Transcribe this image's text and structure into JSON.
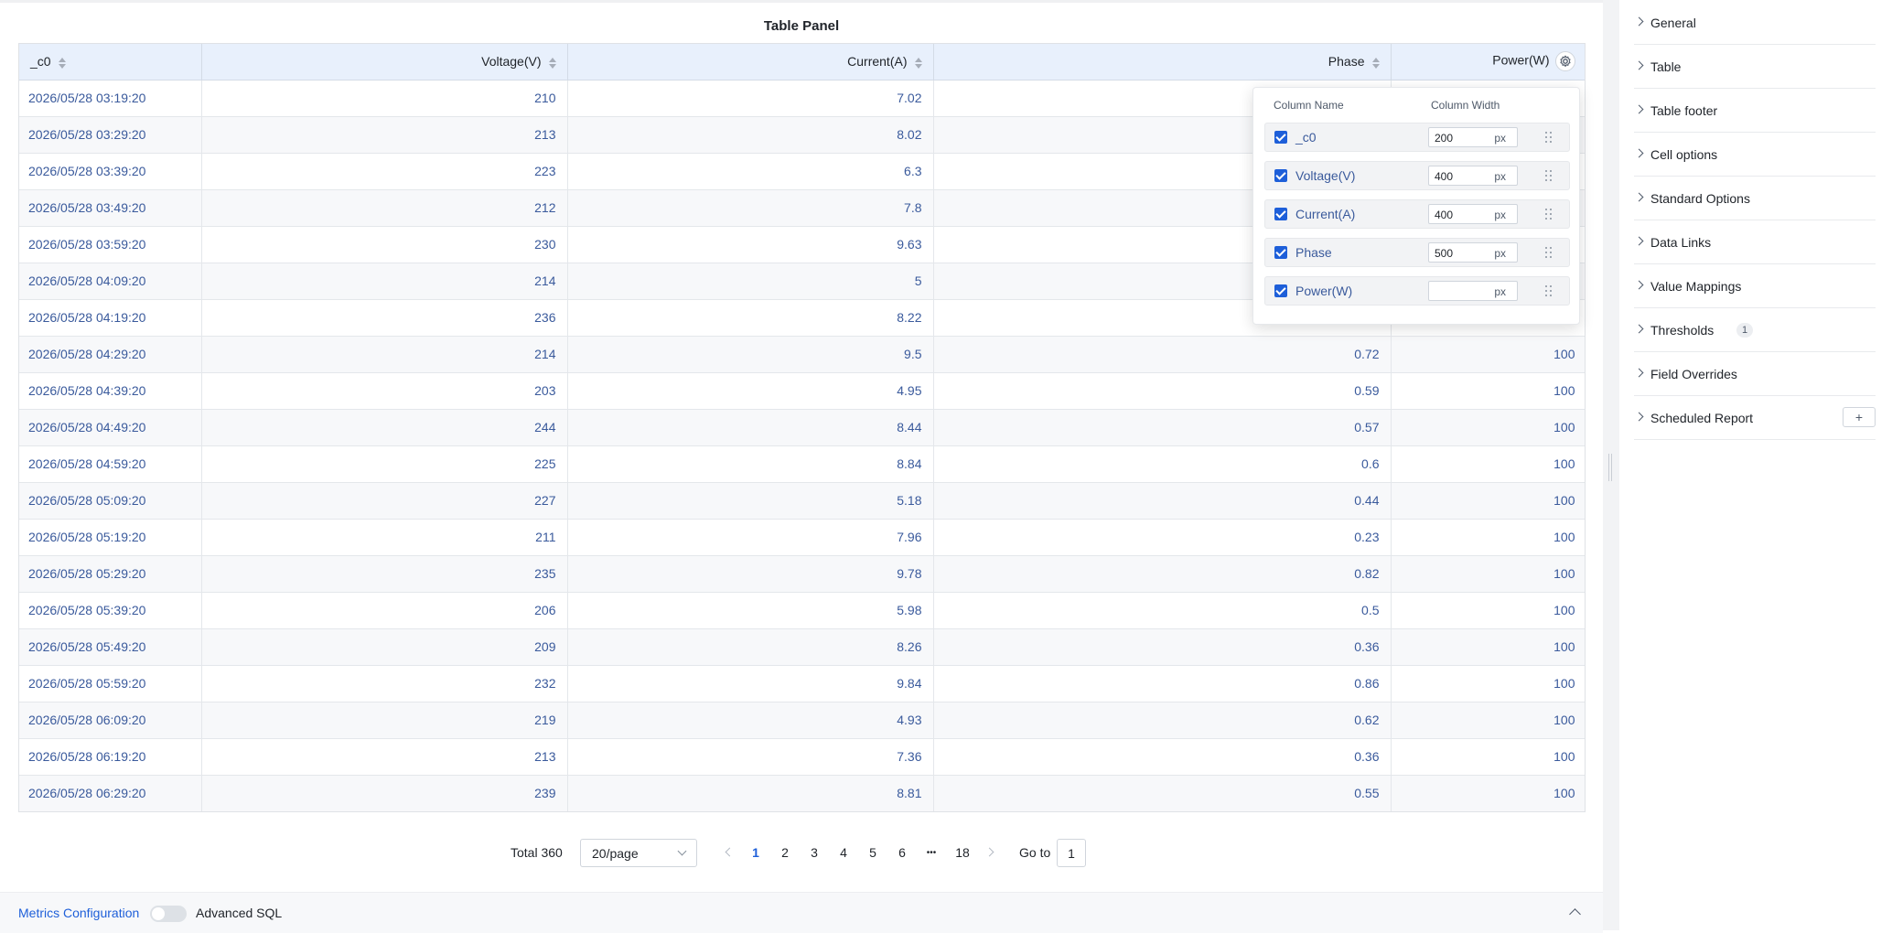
{
  "panel": {
    "title": "Table Panel"
  },
  "table": {
    "columns": [
      {
        "label": "_c0"
      },
      {
        "label": "Voltage(V)"
      },
      {
        "label": "Current(A)"
      },
      {
        "label": "Phase"
      },
      {
        "label": "Power(W)"
      }
    ],
    "rows": [
      [
        "2026/05/28 03:19:20",
        "210",
        "7.02",
        "",
        ""
      ],
      [
        "2026/05/28 03:29:20",
        "213",
        "8.02",
        "",
        ""
      ],
      [
        "2026/05/28 03:39:20",
        "223",
        "6.3",
        "",
        ""
      ],
      [
        "2026/05/28 03:49:20",
        "212",
        "7.8",
        "",
        ""
      ],
      [
        "2026/05/28 03:59:20",
        "230",
        "9.63",
        "",
        ""
      ],
      [
        "2026/05/28 04:09:20",
        "214",
        "5",
        "",
        ""
      ],
      [
        "2026/05/28 04:19:20",
        "236",
        "8.22",
        "",
        ""
      ],
      [
        "2026/05/28 04:29:20",
        "214",
        "9.5",
        "0.72",
        "100"
      ],
      [
        "2026/05/28 04:39:20",
        "203",
        "4.95",
        "0.59",
        "100"
      ],
      [
        "2026/05/28 04:49:20",
        "244",
        "8.44",
        "0.57",
        "100"
      ],
      [
        "2026/05/28 04:59:20",
        "225",
        "8.84",
        "0.6",
        "100"
      ],
      [
        "2026/05/28 05:09:20",
        "227",
        "5.18",
        "0.44",
        "100"
      ],
      [
        "2026/05/28 05:19:20",
        "211",
        "7.96",
        "0.23",
        "100"
      ],
      [
        "2026/05/28 05:29:20",
        "235",
        "9.78",
        "0.82",
        "100"
      ],
      [
        "2026/05/28 05:39:20",
        "206",
        "5.98",
        "0.5",
        "100"
      ],
      [
        "2026/05/28 05:49:20",
        "209",
        "8.26",
        "0.36",
        "100"
      ],
      [
        "2026/05/28 05:59:20",
        "232",
        "9.84",
        "0.86",
        "100"
      ],
      [
        "2026/05/28 06:09:20",
        "219",
        "4.93",
        "0.62",
        "100"
      ],
      [
        "2026/05/28 06:19:20",
        "213",
        "7.36",
        "0.36",
        "100"
      ],
      [
        "2026/05/28 06:29:20",
        "239",
        "8.81",
        "0.55",
        "100"
      ]
    ]
  },
  "column_settings": {
    "header_name": "Column Name",
    "header_width": "Column Width",
    "unit": "px",
    "items": [
      {
        "name": "_c0",
        "width": "200",
        "checked": true
      },
      {
        "name": "Voltage(V)",
        "width": "400",
        "checked": true
      },
      {
        "name": "Current(A)",
        "width": "400",
        "checked": true
      },
      {
        "name": "Phase",
        "width": "500",
        "checked": true
      },
      {
        "name": "Power(W)",
        "width": "",
        "checked": true
      }
    ]
  },
  "pagination": {
    "total": "Total 360",
    "page_size": "20/page",
    "pages": [
      "1",
      "2",
      "3",
      "4",
      "5",
      "6"
    ],
    "ellipsis": "•••",
    "last_page": "18",
    "current": "1",
    "goto_label": "Go to",
    "goto_value": "1"
  },
  "bottom_bar": {
    "metrics_link": "Metrics Configuration",
    "advanced_sql": "Advanced SQL",
    "advanced_sql_enabled": false
  },
  "sidebar": {
    "items": [
      {
        "label": "General"
      },
      {
        "label": "Table"
      },
      {
        "label": "Table footer"
      },
      {
        "label": "Cell options"
      },
      {
        "label": "Standard Options"
      },
      {
        "label": "Data Links"
      },
      {
        "label": "Value Mappings"
      },
      {
        "label": "Thresholds",
        "badge": "1"
      },
      {
        "label": "Field Overrides"
      },
      {
        "label": "Scheduled Report",
        "action": "+"
      }
    ]
  },
  "colors": {
    "accent": "#1e5fd9",
    "cell_text": "#3a5a9c",
    "header_bg": "#e8f0fc"
  }
}
